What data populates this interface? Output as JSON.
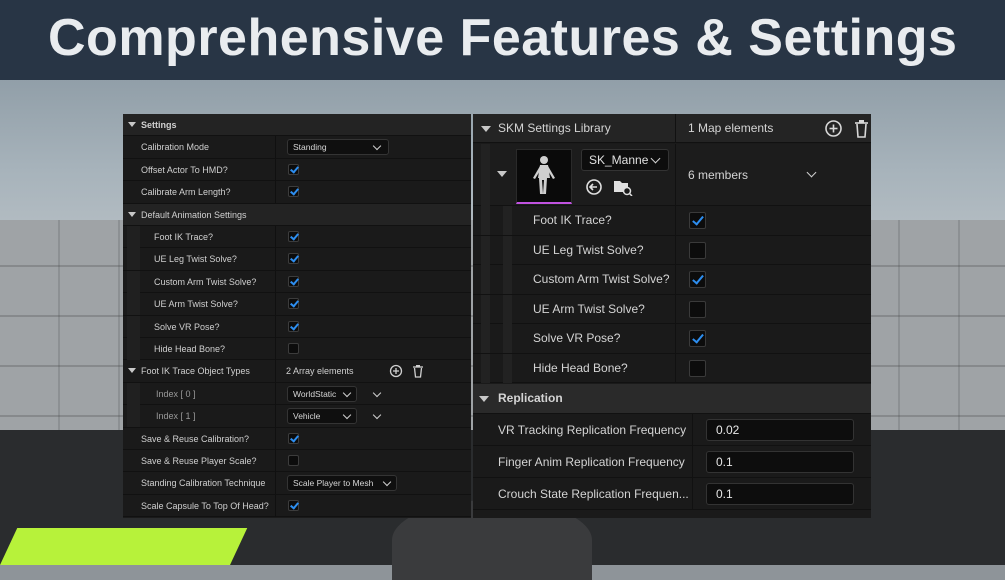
{
  "banner": {
    "title": "Comprehensive Features & Settings"
  },
  "left_panel": {
    "settings_header": "Settings",
    "rows": [
      {
        "label": "Calibration Mode",
        "type": "dropdown",
        "value": "Standing"
      },
      {
        "label": "Offset Actor To HMD?",
        "type": "checkbox",
        "checked": true
      },
      {
        "label": "Calibrate Arm Length?",
        "type": "checkbox",
        "checked": true
      }
    ],
    "default_anim_header": "Default Animation Settings",
    "anim_rows": [
      {
        "label": "Foot IK Trace?",
        "checked": true
      },
      {
        "label": "UE Leg Twist Solve?",
        "checked": true
      },
      {
        "label": "Custom Arm Twist Solve?",
        "checked": true
      },
      {
        "label": "UE Arm Twist Solve?",
        "checked": true
      },
      {
        "label": "Solve VR Pose?",
        "checked": true
      },
      {
        "label": "Hide Head Bone?",
        "checked": false
      }
    ],
    "foot_ik_types": {
      "label": "Foot IK Trace Object Types",
      "count_text": "2 Array elements",
      "items": [
        {
          "index": "Index [ 0 ]",
          "value": "WorldStatic"
        },
        {
          "index": "Index [ 1 ]",
          "value": "Vehicle"
        }
      ]
    },
    "bottom_rows": [
      {
        "label": "Save & Reuse Calibration?",
        "type": "checkbox",
        "checked": true
      },
      {
        "label": "Save & Reuse Player Scale?",
        "type": "checkbox",
        "checked": false
      },
      {
        "label": "Standing Calibration Technique",
        "type": "dropdown",
        "value": "Scale Player to Mesh"
      },
      {
        "label": "Scale Capsule To Top Of Head?",
        "type": "checkbox",
        "checked": true
      }
    ]
  },
  "right_panel": {
    "library_label": "SKM Settings Library",
    "map_count": "1 Map elements",
    "asset_name": "SK_Manne",
    "members": "6 members",
    "member_rows": [
      {
        "label": "Foot IK Trace?",
        "checked": true
      },
      {
        "label": "UE Leg Twist Solve?",
        "checked": false
      },
      {
        "label": "Custom Arm Twist Solve?",
        "checked": true
      },
      {
        "label": "UE Arm Twist Solve?",
        "checked": false
      },
      {
        "label": "Solve VR Pose?",
        "checked": true
      },
      {
        "label": "Hide Head Bone?",
        "checked": false
      }
    ],
    "replication_header": "Replication",
    "replication_rows": [
      {
        "label": "VR Tracking Replication Frequency",
        "value": "0.02"
      },
      {
        "label": "Finger Anim Replication Frequency",
        "value": "0.1"
      },
      {
        "label": "Crouch State Replication Frequen...",
        "value": "0.1"
      }
    ]
  },
  "colors": {
    "accent": "#2d8ef0",
    "banner_bg": "#283545",
    "panel_bg": "#1a1a1a",
    "highlight_green": "#b7f23a"
  }
}
